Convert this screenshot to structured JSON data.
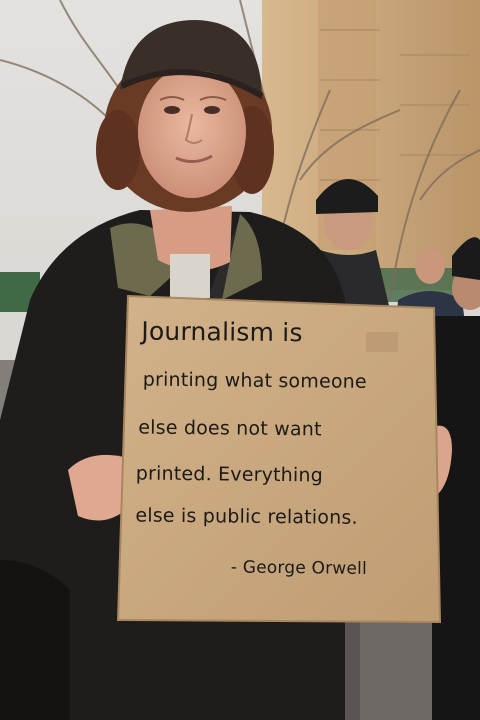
{
  "sign": {
    "line1": "Journalism is",
    "line2": "printing what someone",
    "line3": "else does not want",
    "line4": "printed. Everything",
    "line5": "else is public relations.",
    "attribution": "- George Orwell"
  },
  "colors": {
    "cardboard": "#c9a87f",
    "ink": "#1c1a18",
    "sky": "#dcdad8",
    "building": "#c9a57b",
    "jacket": "#1f1d1c",
    "hat": "#3a2e29"
  }
}
